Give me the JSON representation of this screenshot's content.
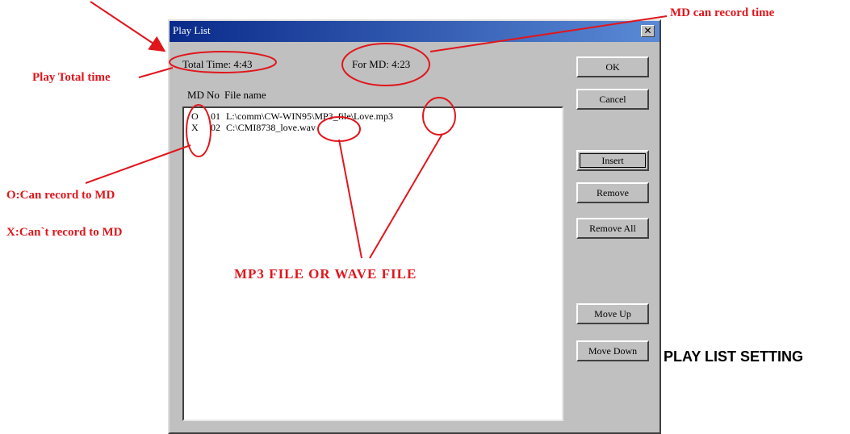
{
  "window": {
    "title": "Play List",
    "close_glyph": "✕"
  },
  "info": {
    "total_time": "Total Time: 4:43",
    "for_md": "For MD: 4:23"
  },
  "columns": [
    "MD",
    "No",
    "File name"
  ],
  "rows": [
    {
      "md": "O",
      "no": "01",
      "file": "L:\\comm\\CW-WIN95\\MP3_file\\Love.mp3"
    },
    {
      "md": "X",
      "no": "02",
      "file": "C:\\CMI8738_love.wav"
    }
  ],
  "buttons": {
    "ok": "OK",
    "cancel": "Cancel",
    "insert": "Insert",
    "remove": "Remove",
    "remove_all": "Remove All",
    "move_up": "Move Up",
    "move_down": "Move Down"
  },
  "annotations": {
    "md_can_record_time": "MD can record time",
    "play_total_time": "Play Total time",
    "can_record": "O:Can record to MD",
    "cant_record": "X:Can`t record to MD",
    "file_type": "MP3 FILE OR WAVE FILE",
    "annotation_color": "#e0161c"
  },
  "heading": "PLAY LIST SETTING"
}
